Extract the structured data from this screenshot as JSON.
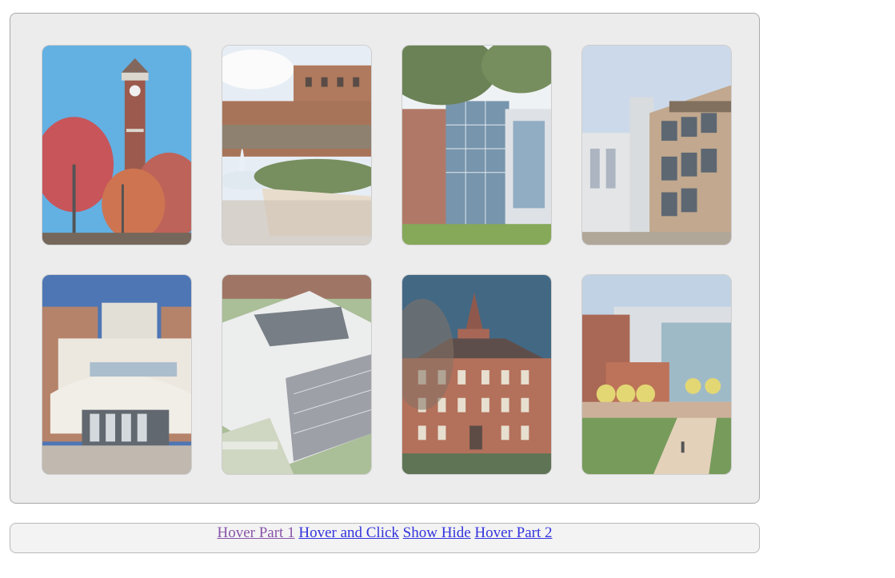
{
  "gallery": {
    "images": [
      {
        "name": "bell-tower-photo"
      },
      {
        "name": "fountain-building-photo"
      },
      {
        "name": "glass-engineering-hall-photo"
      },
      {
        "name": "purdue-research-center-photo"
      },
      {
        "name": "computer-science-building-photo"
      },
      {
        "name": "aerial-rendering-photo"
      },
      {
        "name": "historic-hall-photo"
      },
      {
        "name": "new-building-courtyard-photo"
      }
    ]
  },
  "nav": {
    "links": [
      {
        "label": "Hover Part 1",
        "visited": true
      },
      {
        "label": "Hover and Click",
        "visited": false
      },
      {
        "label": "Show Hide",
        "visited": false
      },
      {
        "label": "Hover Part 2",
        "visited": false
      }
    ]
  }
}
